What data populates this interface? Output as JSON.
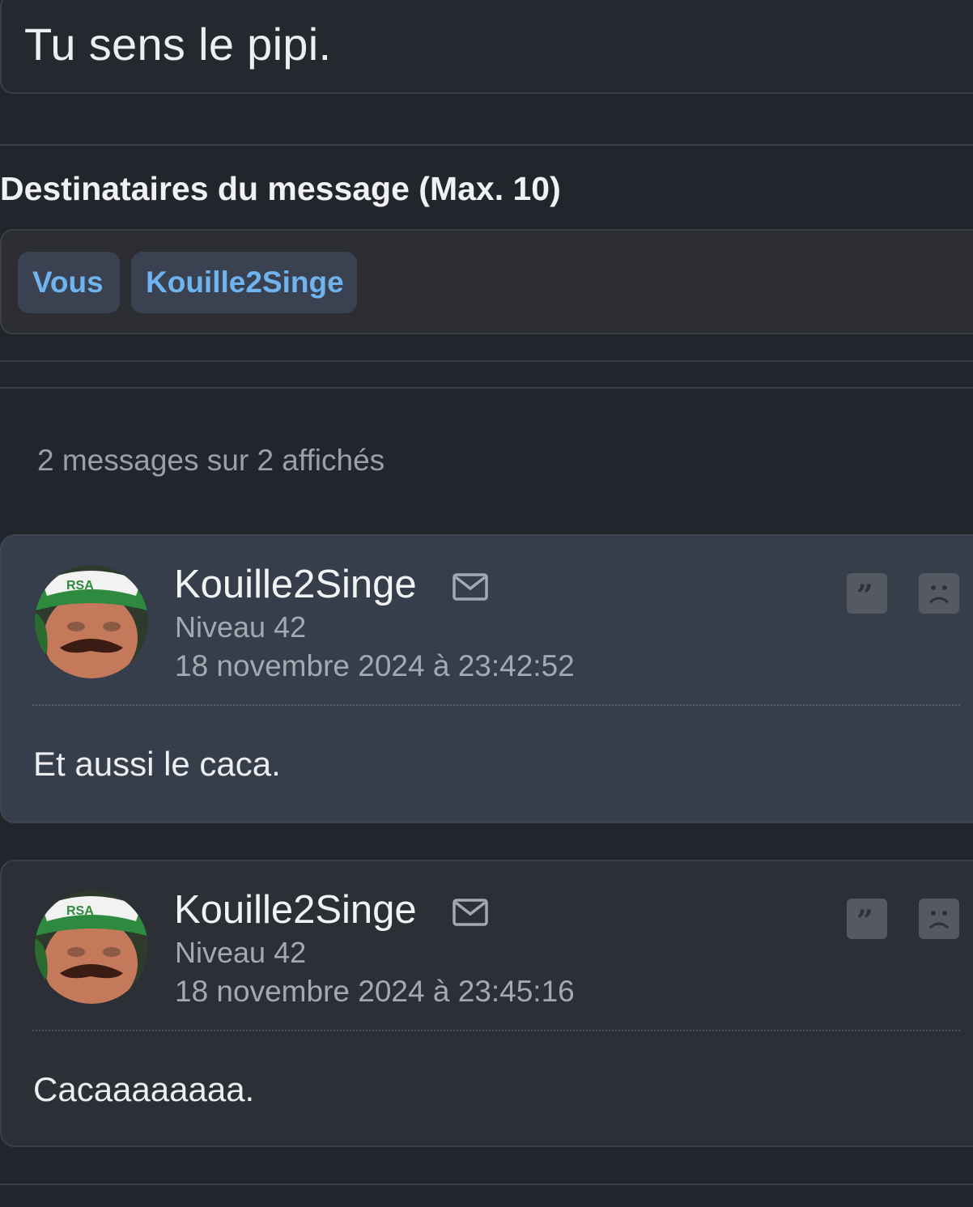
{
  "subject": "Tu sens le pipi.",
  "recipients": {
    "title": "Destinataires du message (Max. 10)",
    "chips": [
      "Vous",
      "Kouille2Singe"
    ]
  },
  "messages_count": "2 messages sur 2 affichés",
  "messages": [
    {
      "author": "Kouille2Singe",
      "level": "Niveau 42",
      "date": "18 novembre 2024 à 23:42:52",
      "body": "Et aussi le caca.",
      "avatar_cap_text": "RSA"
    },
    {
      "author": "Kouille2Singe",
      "level": "Niveau 42",
      "date": "18 novembre 2024 à 23:45:16",
      "body": "Cacaaaaaaaa.",
      "avatar_cap_text": "RSA"
    }
  ],
  "icons": {
    "mail": "mail-icon",
    "quote": "quote-icon",
    "report": "sad-face-icon"
  },
  "colors": {
    "background": "#22252b",
    "chip_text": "#6fb4ee",
    "chip_bg": "#3a4251",
    "highlight_message_bg": "#363e4b"
  }
}
